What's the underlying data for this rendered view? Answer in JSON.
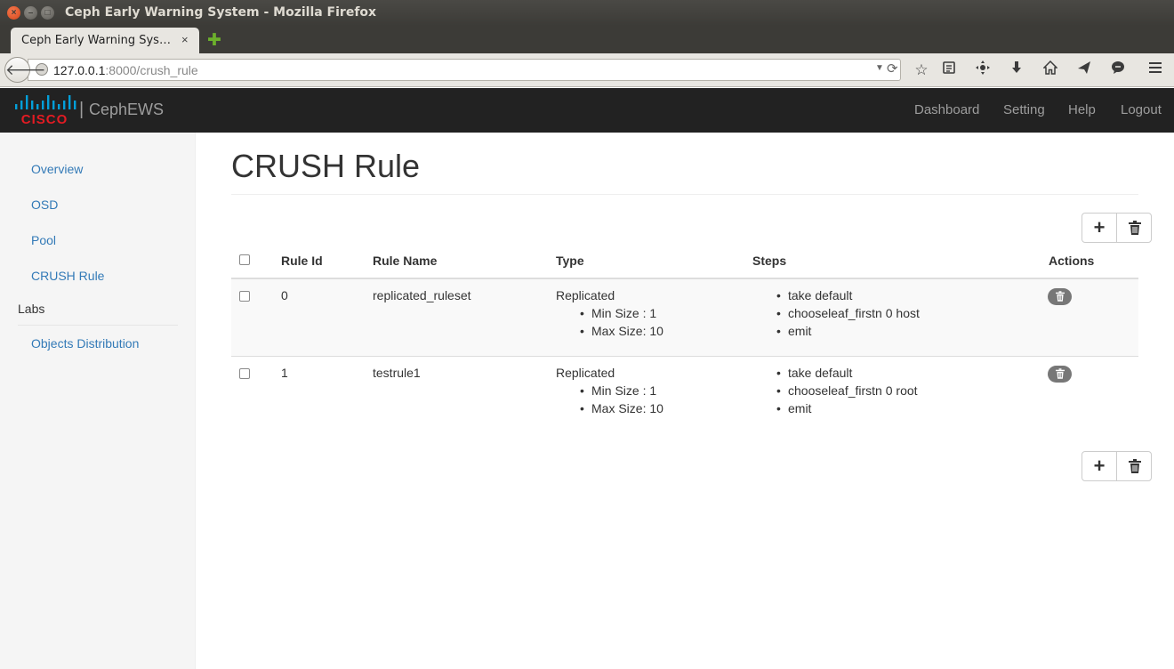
{
  "window": {
    "title": "Ceph Early Warning System - Mozilla Firefox",
    "close_glyph": "×",
    "min_glyph": "–",
    "max_glyph": "□"
  },
  "browser": {
    "tab_label": "Ceph Early Warning Sys…",
    "tab_close": "×",
    "new_tab": "✚",
    "url_host": "127.0.0.1",
    "url_rest": ":8000/crush_rule",
    "toolbar_icons": [
      "bookmark-star-icon",
      "reading-list-icon",
      "pocket-icon",
      "download-icon",
      "home-icon",
      "send-icon",
      "chat-icon",
      "menu-icon"
    ]
  },
  "app": {
    "brand": "CephEWS",
    "brand_separator": "|",
    "logo_text": "CISCO",
    "logo_colors": {
      "bars": "#049fd9",
      "text": "#e31b23"
    },
    "nav": [
      "Dashboard",
      "Setting",
      "Help",
      "Logout"
    ]
  },
  "sidebar": {
    "items": [
      "Overview",
      "OSD",
      "Pool",
      "CRUSH Rule"
    ],
    "labs_header": "Labs",
    "labs_items": [
      "Objects Distribution"
    ]
  },
  "main": {
    "title": "CRUSH Rule",
    "columns": [
      "Rule Id",
      "Rule Name",
      "Type",
      "Steps",
      "Actions"
    ],
    "rows": [
      {
        "id": "0",
        "name": "replicated_ruleset",
        "type": "Replicated",
        "type_details": [
          "Min Size : 1",
          "Max Size: 10"
        ],
        "steps": [
          "take default",
          "chooseleaf_firstn 0 host",
          "emit"
        ]
      },
      {
        "id": "1",
        "name": "testrule1",
        "type": "Replicated",
        "type_details": [
          "Min Size : 1",
          "Max Size: 10"
        ],
        "steps": [
          "take default",
          "chooseleaf_firstn 0 root",
          "emit"
        ]
      }
    ],
    "add_glyph": "+",
    "colors": {
      "link": "#337ab7",
      "navbar": "#222222",
      "stripe": "#f9f9f9",
      "badge": "#777777"
    }
  }
}
